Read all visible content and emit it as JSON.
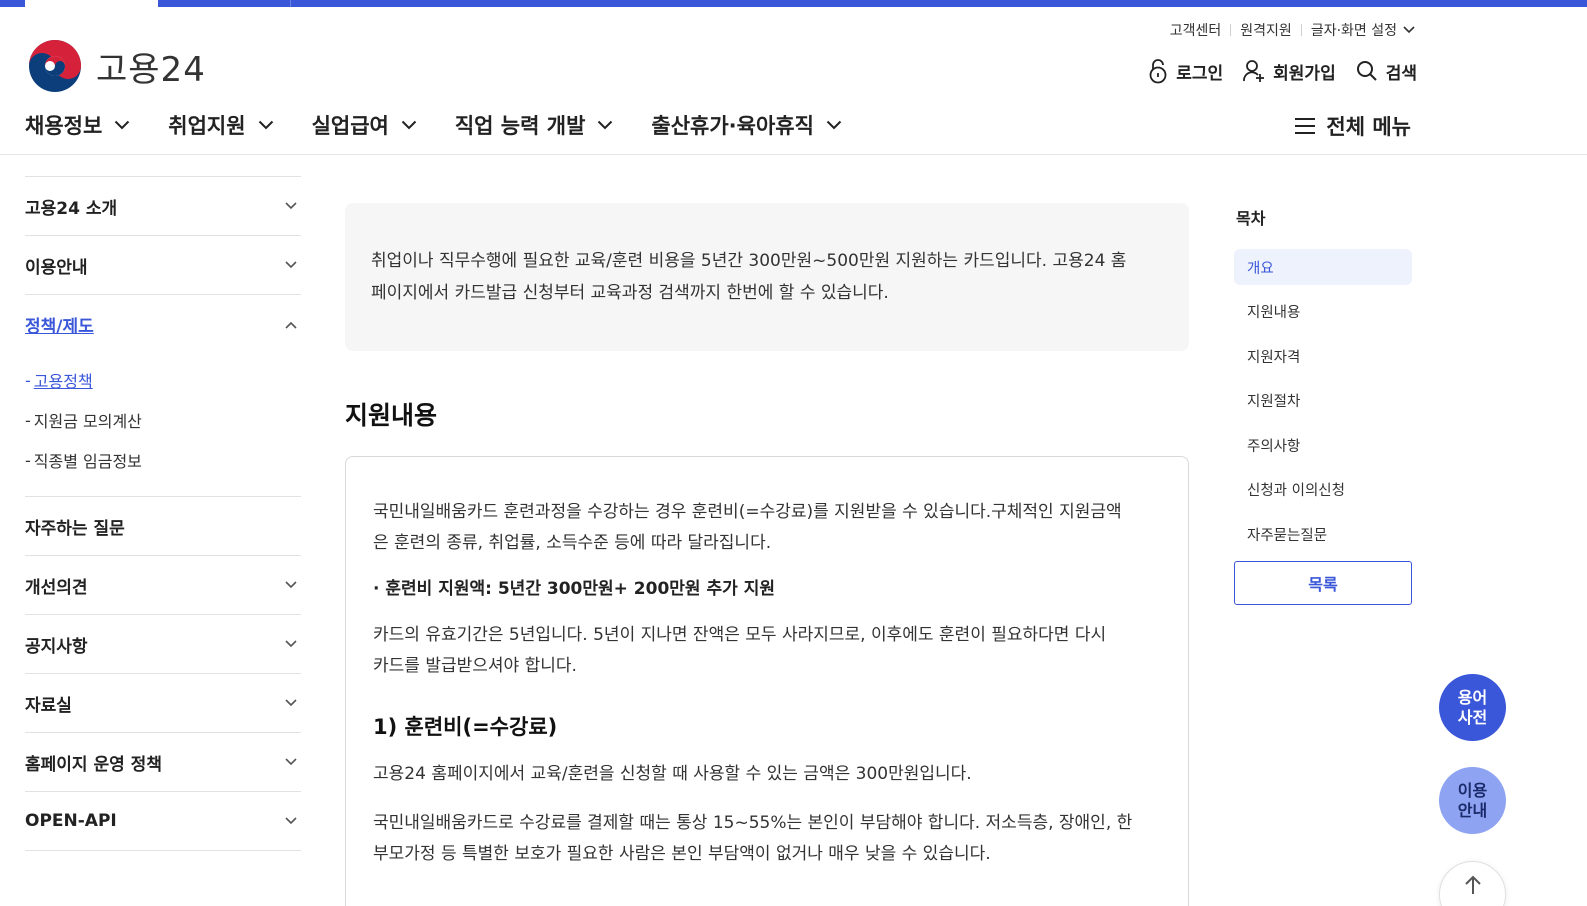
{
  "brand": {
    "logo_text": "고용24",
    "accent": "#3b57d9"
  },
  "util_links": [
    "고객센터",
    "원격지원",
    "글자·화면 설정"
  ],
  "user_links": {
    "login": "로그인",
    "signup": "회원가입",
    "search": "검색"
  },
  "gnb": [
    "채용정보",
    "취업지원",
    "실업급여",
    "직업 능력 개발",
    "출산휴가·육아휴직"
  ],
  "all_menu": "전체 메뉴",
  "lnb": {
    "items_before": [
      "고용24 소개",
      "이용안내"
    ],
    "open_item": "정책/제도",
    "sub_items": [
      {
        "dash": "-",
        "label": "고용정책"
      },
      {
        "dash": "-",
        "label": "지원금 모의계산"
      },
      {
        "dash": "-",
        "label": "직종별 임금정보"
      }
    ],
    "items_after": [
      "자주하는 질문",
      "개선의견",
      "공지사항",
      "자료실",
      "홈페이지 운영 정책",
      "OPEN-API"
    ]
  },
  "content": {
    "summary_line1": "취업이나 직무수행에 필요한 교육/훈련 비용을 5년간 300만원~500만원 지원하는 카드입니다. 고용24 홈",
    "summary_line2": "페이지에서 카드발급 신청부터 교육과정 검색까지 한번에 할 수 있습니다.",
    "section_title": "지원내용",
    "para1_line1": "국민내일배움카드 훈련과정을 수강하는 경우 훈련비(=수강료)를 지원받을 수 있습니다.구체적인 지원금액",
    "para1_line2": "은 훈련의 종류, 취업률, 소득수준 등에 따라 달라집니다.",
    "bold_line": "· 훈련비 지원액: 5년간 300만원+ 200만원 추가 지원",
    "para2_line1": "카드의 유효기간은 5년입니다. 5년이 지나면 잔액은 모두 사라지므로, 이후에도 훈련이 필요하다면 다시",
    "para2_line2": "카드를 발급받으셔야 합니다.",
    "sub_heading": "1) 훈련비(=수강료)",
    "para3": "고용24 홈페이지에서 교육/훈련을 신청할 때 사용할 수 있는 금액은 300만원입니다.",
    "para4_line1": "국민내일배움카드로 수강료를 결제할 때는 통상 15~55%는 본인이 부담해야 합니다. 저소득층, 장애인, 한",
    "para4_line2": "부모가정 등 특별한 보호가 필요한 사람은 본인 부담액이 없거나 매우 낮을 수 있습니다."
  },
  "toc": {
    "title": "목차",
    "items": [
      "개요",
      "지원내용",
      "지원자격",
      "지원절차",
      "주의사항",
      "신청과 이의신청",
      "자주묻는질문"
    ],
    "list_button": "목록"
  },
  "floating": {
    "glossary_l1": "용어",
    "glossary_l2": "사전",
    "guide_l1": "이용",
    "guide_l2": "안내"
  },
  "icons": {
    "login": "lock-icon",
    "signup": "user-plus-icon",
    "search": "search-icon",
    "menu": "hamburger-icon",
    "chevron": "chevron-down-icon",
    "top": "arrow-up-icon"
  }
}
